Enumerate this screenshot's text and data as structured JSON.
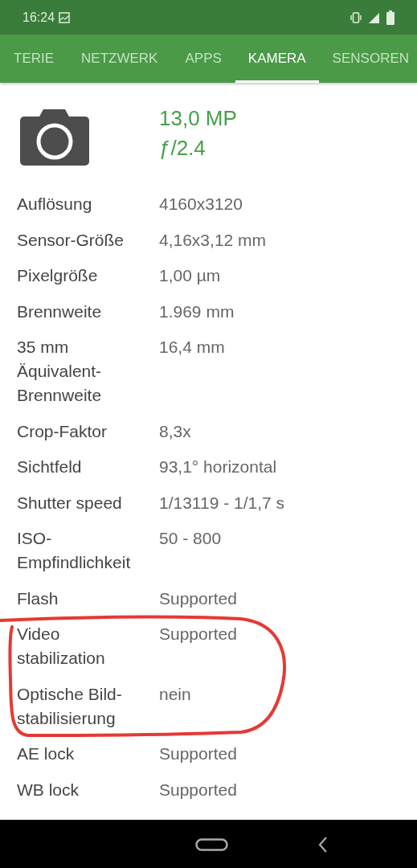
{
  "status_bar": {
    "time": "16:24"
  },
  "tabs": [
    {
      "label": "TERIE",
      "selected": false
    },
    {
      "label": "NETZWERK",
      "selected": false
    },
    {
      "label": "APPS",
      "selected": false
    },
    {
      "label": "KAMERA",
      "selected": true
    },
    {
      "label": "SENSOREN",
      "selected": false
    }
  ],
  "header": {
    "resolution": "13,0 MP",
    "aperture": "ƒ/2.4"
  },
  "specs": [
    {
      "label": "Auflösung",
      "value": "4160x3120"
    },
    {
      "label": "Sensor-Größe",
      "value": "4,16x3,12 mm"
    },
    {
      "label": "Pixelgröße",
      "value": "1,00 µm"
    },
    {
      "label": "Brennweite",
      "value": "1.969 mm"
    },
    {
      "label": "35 mm Äquivalent-Brennweite",
      "value": "16,4 mm"
    },
    {
      "label": "Crop-Faktor",
      "value": "8,3x"
    },
    {
      "label": "Sichtfeld",
      "value": "93,1° horizontal"
    },
    {
      "label": "Shutter speed",
      "value": "1/13119 - 1/1,7 s"
    },
    {
      "label": "ISO-Empfindlichkeit",
      "value": "50 - 800"
    },
    {
      "label": "Flash",
      "value": "Supported"
    },
    {
      "label": "Video stabilization",
      "value": "Supported"
    },
    {
      "label": "Optische Bild-stabilisierung",
      "value": "nein"
    },
    {
      "label": "AE lock",
      "value": "Supported"
    },
    {
      "label": "WB lock",
      "value": "Supported"
    }
  ]
}
